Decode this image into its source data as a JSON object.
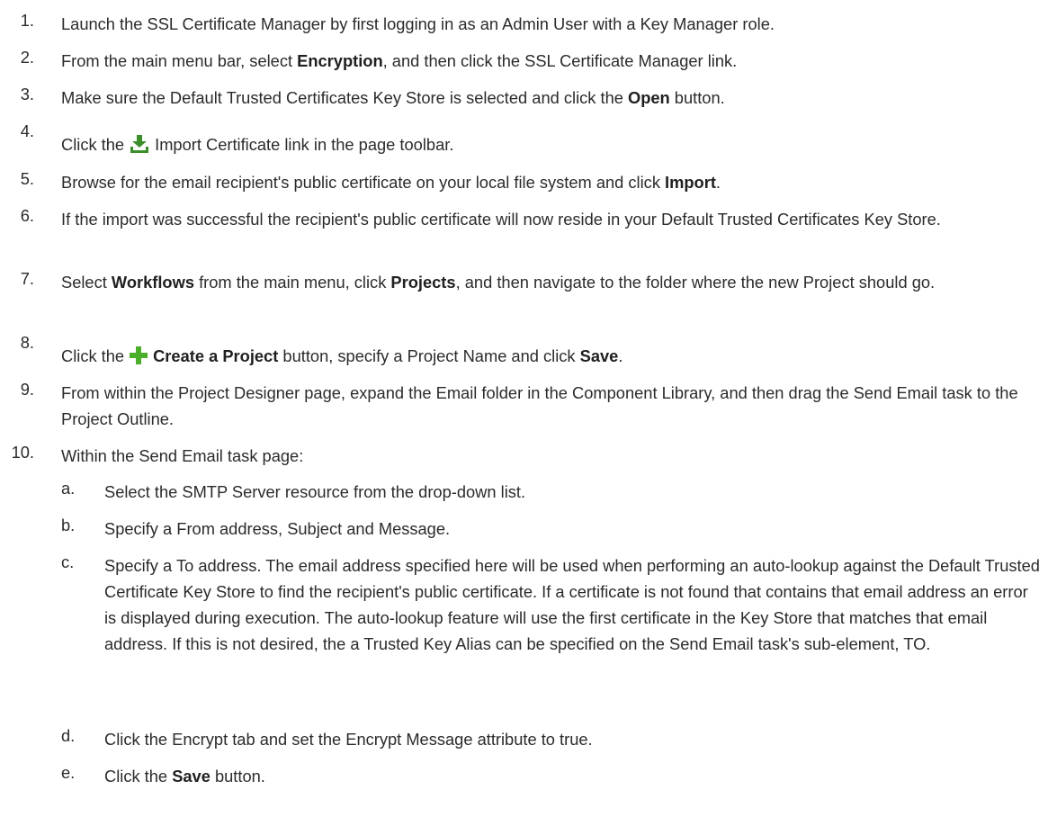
{
  "steps": [
    {
      "num": "1.",
      "text": "Launch the SSL Certificate Manager by first logging in as an Admin User with a Key Manager role."
    },
    {
      "num": "2.",
      "a": "From the main menu bar, select ",
      "b": "Encryption",
      "c": ", and then click the SSL Certificate Manager link."
    },
    {
      "num": "3.",
      "a": "Make sure the Default Trusted Certificates Key Store is selected and click the ",
      "b": "Open",
      "c": " button."
    },
    {
      "num": "4.",
      "a": "Click the",
      "icon": "import-download-icon",
      "c": "Import Certificate link in the page toolbar."
    },
    {
      "num": "5.",
      "a": "Browse for the email recipient's public certificate on your local file system and click ",
      "b": "Import",
      "c": "."
    },
    {
      "num": "6.",
      "text": "If the import was successful the recipient's public certificate will now reside in your Default Trusted Certificates Key Store."
    },
    {
      "num": "7.",
      "a": "Select ",
      "b": "Workflows",
      "c": " from the main menu, click ",
      "d": "Projects",
      "e": ", and then navigate to the folder where the new Project should go."
    },
    {
      "num": "8.",
      "a": "Click the",
      "icon": "green-plus-icon",
      "b": "Create a Project",
      "c": " button, specify a Project Name and click ",
      "d": "Save",
      "e": "."
    },
    {
      "num": "9.",
      "text": "From within the Project Designer page, expand the Email folder in the Component Library, and then drag the Send Email task to the Project Outline."
    },
    {
      "num": "10.",
      "text": "Within the Send Email task page:"
    }
  ],
  "substeps": [
    {
      "num": "a.",
      "text": "Select the SMTP Server resource from the drop-down list."
    },
    {
      "num": "b.",
      "text": "Specify a From address, Subject and Message."
    },
    {
      "num": "c.",
      "text": "Specify a To address. The email address specified here will be used when performing an auto-lookup against the Default Trusted Certificate Key Store to find the recipient's public certificate. If a certificate is not found that contains that email address an error is displayed during execution. The auto-lookup feature will use the first certificate in the Key Store that matches that email address. If this is not desired, the a Trusted Key Alias can be specified on the Send Email task's sub-element, TO."
    },
    {
      "num": "d.",
      "text": "Click the Encrypt tab and set the Encrypt Message attribute to true."
    },
    {
      "num": "e.",
      "a": "Click the ",
      "b": "Save",
      "c": " button."
    }
  ]
}
